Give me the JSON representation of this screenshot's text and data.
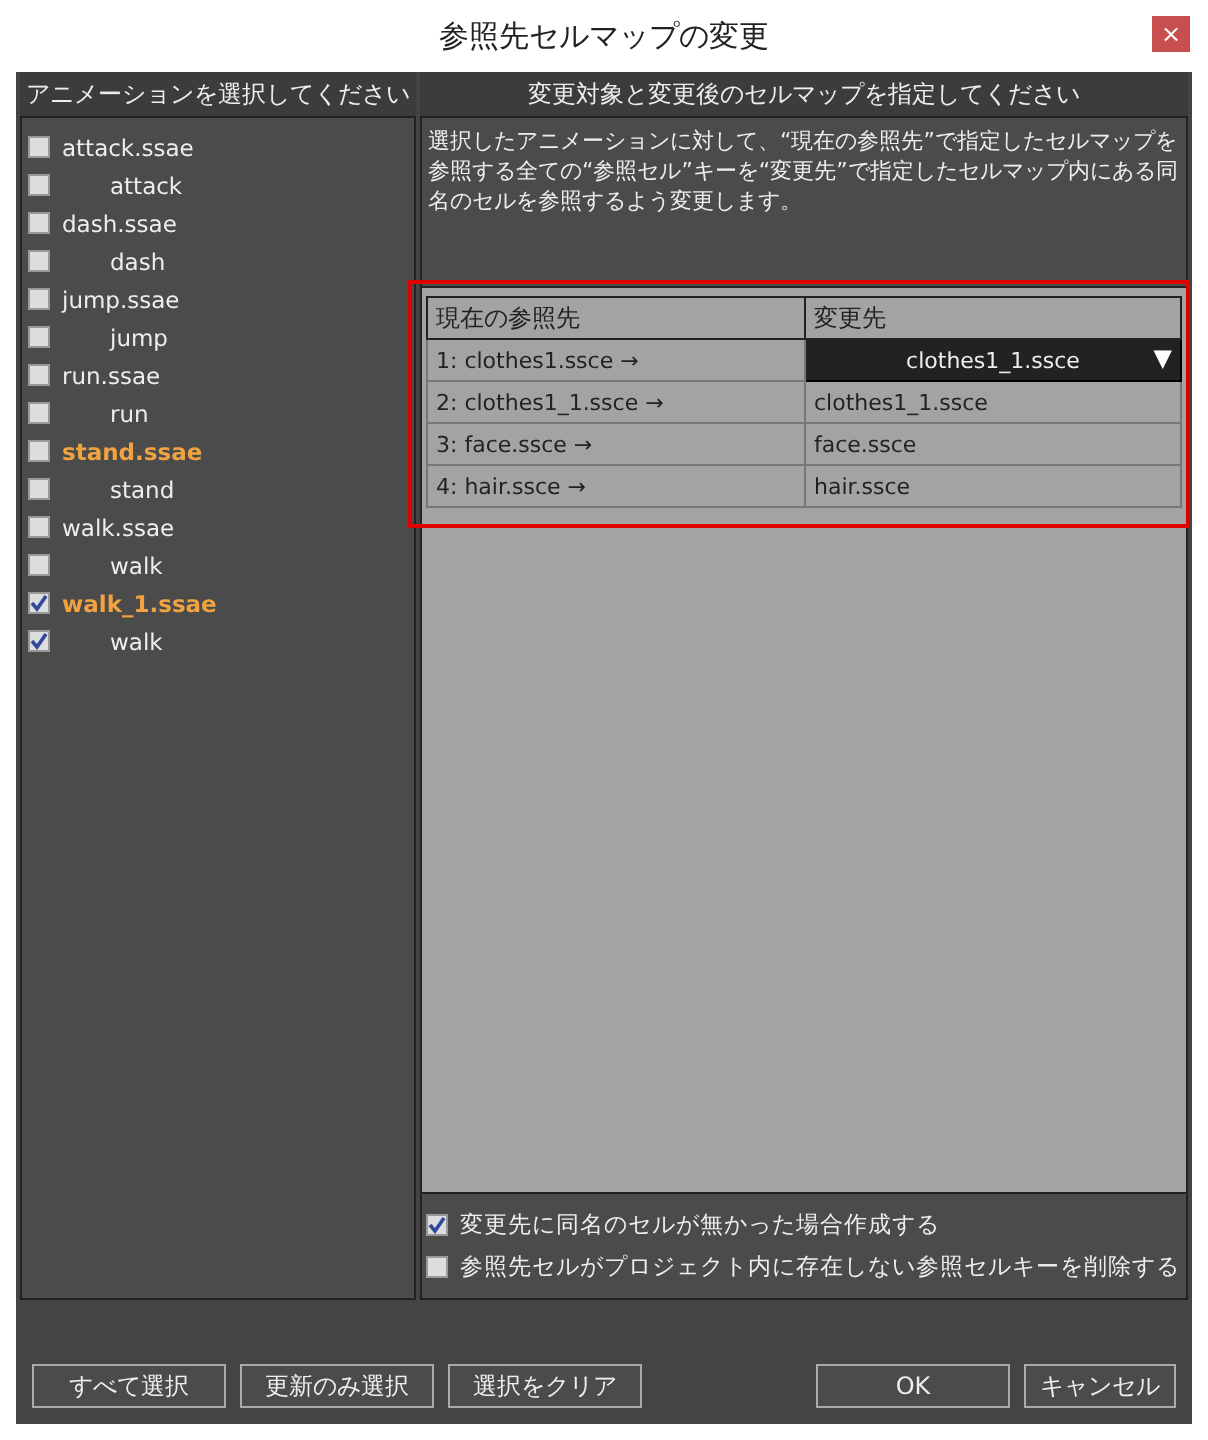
{
  "window": {
    "title": "参照先セルマップの変更",
    "close": "×"
  },
  "left_panel": {
    "header": "アニメーションを選択してください",
    "items": [
      {
        "kind": "file",
        "label": "attack.ssae",
        "checked": false,
        "highlighted": false
      },
      {
        "kind": "anim",
        "label": "attack",
        "checked": false,
        "highlighted": false
      },
      {
        "kind": "file",
        "label": "dash.ssae",
        "checked": false,
        "highlighted": false
      },
      {
        "kind": "anim",
        "label": "dash",
        "checked": false,
        "highlighted": false
      },
      {
        "kind": "file",
        "label": "jump.ssae",
        "checked": false,
        "highlighted": false
      },
      {
        "kind": "anim",
        "label": "jump",
        "checked": false,
        "highlighted": false
      },
      {
        "kind": "file",
        "label": "run.ssae",
        "checked": false,
        "highlighted": false
      },
      {
        "kind": "anim",
        "label": "run",
        "checked": false,
        "highlighted": false
      },
      {
        "kind": "file",
        "label": "stand.ssae",
        "checked": false,
        "highlighted": true
      },
      {
        "kind": "anim",
        "label": "stand",
        "checked": false,
        "highlighted": false
      },
      {
        "kind": "file",
        "label": "walk.ssae",
        "checked": false,
        "highlighted": false
      },
      {
        "kind": "anim",
        "label": "walk",
        "checked": false,
        "highlighted": false
      },
      {
        "kind": "file",
        "label": "walk_1.ssae",
        "checked": true,
        "highlighted": true
      },
      {
        "kind": "anim",
        "label": "walk",
        "checked": true,
        "highlighted": false
      }
    ]
  },
  "right_panel": {
    "header": "変更対象と変更後のセルマップを指定してください",
    "description": "選択したアニメーションに対して、“現在の参照先”で指定したセルマップを参照する全ての“参照セル”キーを“変更先”で指定したセルマップ内にある同名のセルを参照するよう変更します。",
    "table": {
      "columns": [
        "現在の参照先",
        "変更先"
      ],
      "rows": [
        {
          "current": "1: clothes1.ssce →",
          "target": "clothes1_1.ssce",
          "editing": true,
          "dropdown_arrow": "▼"
        },
        {
          "current": "2: clothes1_1.ssce →",
          "target": "clothes1_1.ssce",
          "editing": false
        },
        {
          "current": "3: face.ssce →",
          "target": "face.ssce",
          "editing": false
        },
        {
          "current": "4: hair.ssce →",
          "target": "hair.ssce",
          "editing": false
        }
      ]
    },
    "options": [
      {
        "label": "変更先に同名のセルが無かった場合作成する",
        "checked": true
      },
      {
        "label": "参照先セルがプロジェクト内に存在しない参照セルキーを削除する",
        "checked": false
      }
    ]
  },
  "buttons_left": [
    "すべて選択",
    "更新のみ選択",
    "選択をクリア"
  ],
  "buttons_right": [
    "OK",
    "キャンセル"
  ]
}
